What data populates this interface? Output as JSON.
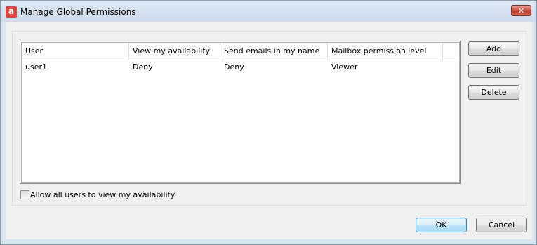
{
  "window": {
    "title": "Manage Global Permissions",
    "app_icon_glyph": "a",
    "close_glyph": "✕"
  },
  "permissions_list": {
    "columns": [
      "User",
      "View my availability",
      "Send emails in my name",
      "Mailbox permission level"
    ],
    "rows": [
      [
        "user1",
        "Deny",
        "Deny",
        "Viewer"
      ]
    ]
  },
  "side_buttons": {
    "add": "Add",
    "edit": "Edit",
    "delete": "Delete"
  },
  "allow_all": {
    "label": "Allow all users to view my availability",
    "checked": false
  },
  "footer": {
    "ok": "OK",
    "cancel": "Cancel"
  },
  "colors": {
    "app_icon": "#e0443a",
    "close_button": "#c7473a",
    "default_button_border": "#3c7fb1"
  }
}
